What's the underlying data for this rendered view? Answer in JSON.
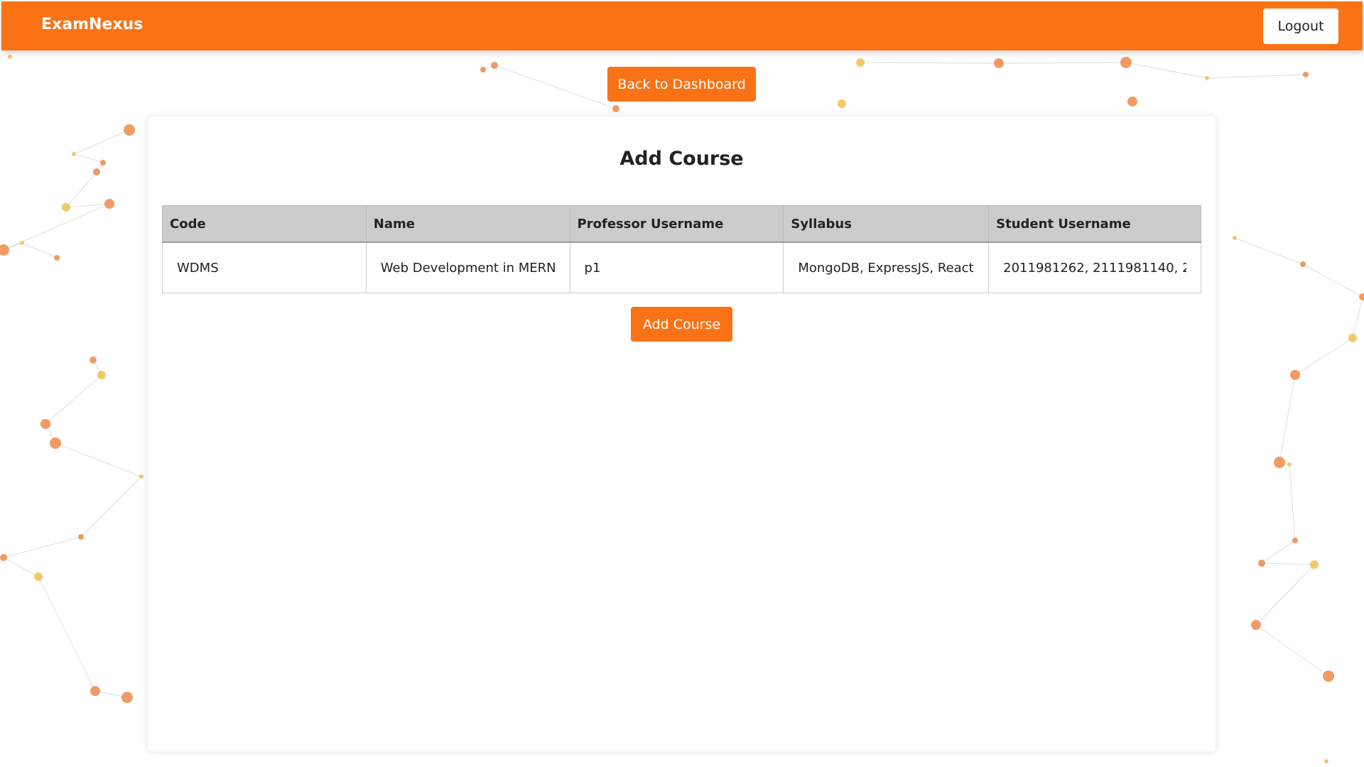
{
  "navbar": {
    "brand": "ExamNexus",
    "logout_label": "Logout"
  },
  "back_label": "Back to Dashboard",
  "page_title": "Add Course",
  "table": {
    "headers": [
      "Code",
      "Name",
      "Professor Username",
      "Syllabus",
      "Student Username"
    ],
    "row": {
      "code": "WDMS",
      "name": "Web Development in MERN",
      "professor": "p1",
      "syllabus": "MongoDB, ExpressJS, React",
      "students": "2011981262, 2111981140, 2"
    }
  },
  "add_label": "Add Course",
  "colors": {
    "accent": "#f97316",
    "header_bg": "#cccccc"
  }
}
